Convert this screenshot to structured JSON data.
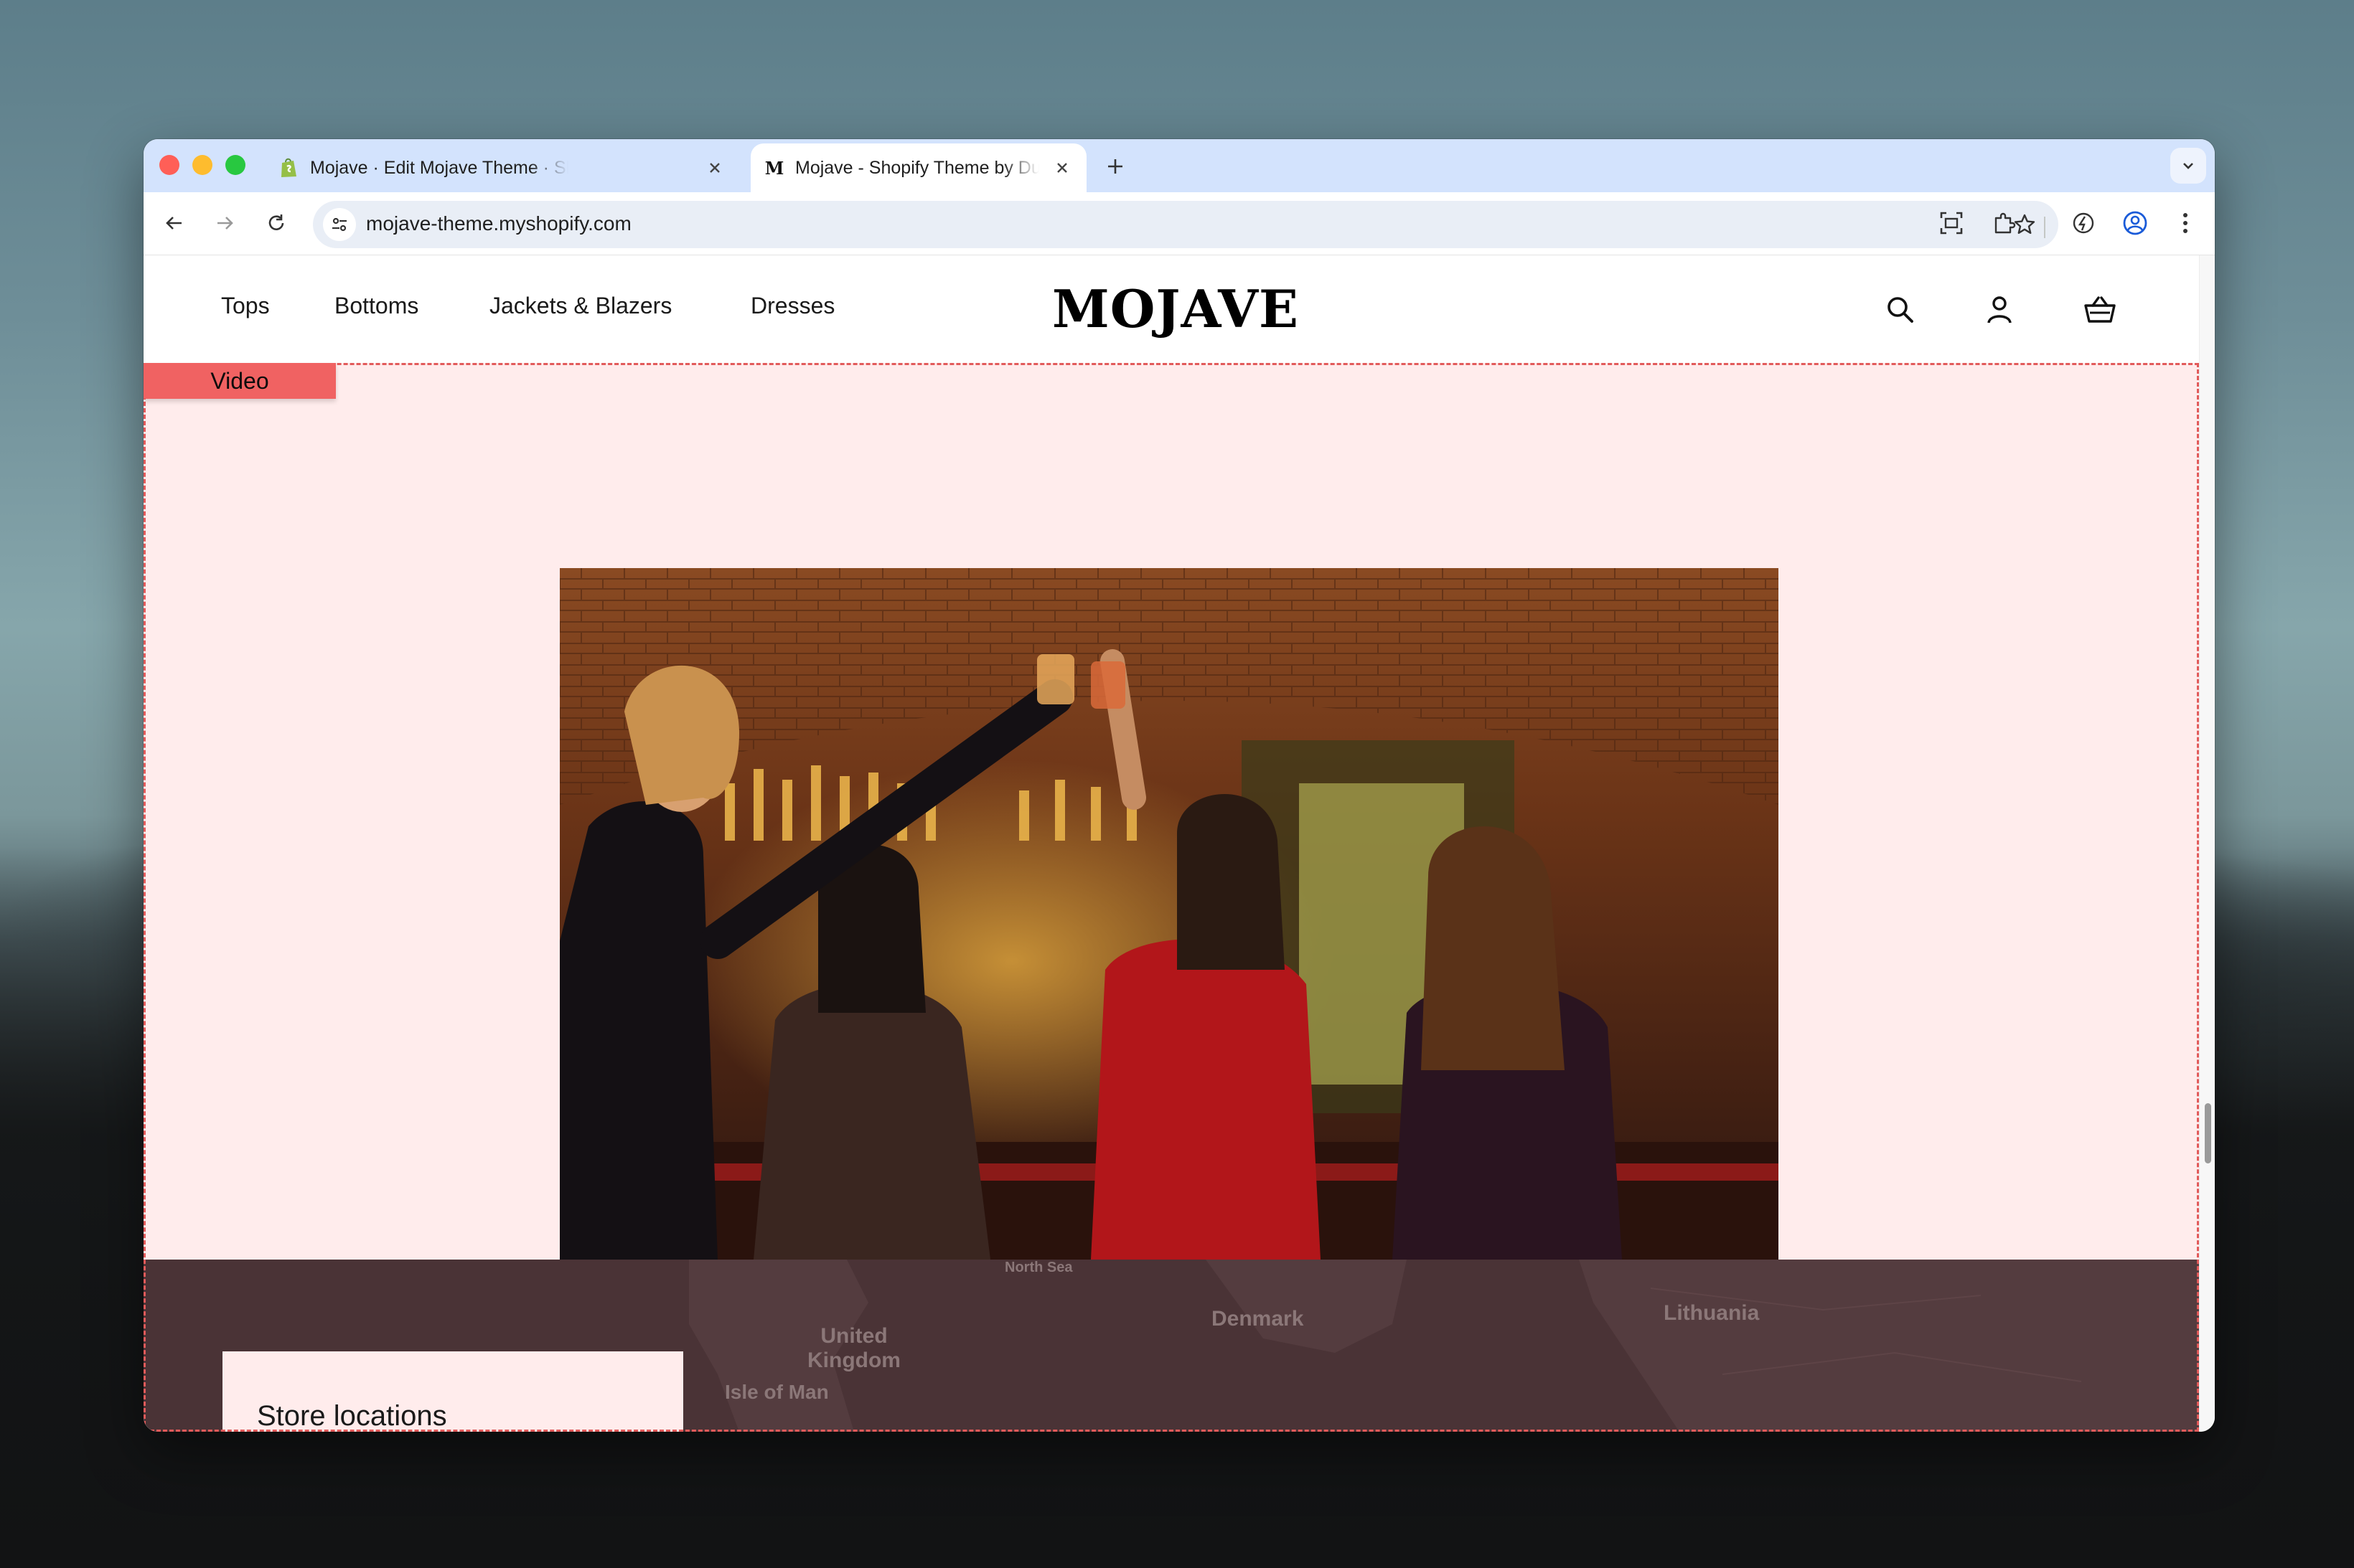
{
  "browser": {
    "tabs": [
      {
        "title": "Mojave · Edit Mojave Theme · Shopify",
        "favicon": "shopify-icon",
        "active": false
      },
      {
        "title": "Mojave - Shopify Theme by Dualyan",
        "favicon": "m-letter-icon",
        "favicon_text": "M",
        "active": true
      }
    ],
    "url": "mojave-theme.myshopify.com"
  },
  "site": {
    "logo": "MOJAVE",
    "nav": [
      "Tops",
      "Bottoms",
      "Jackets & Blazers",
      "Dresses"
    ]
  },
  "editor": {
    "section_label": "Video"
  },
  "map": {
    "labels": {
      "north_sea": "North Sea",
      "uk": "United Kingdom",
      "isle_of_man": "Isle of Man",
      "denmark": "Denmark",
      "lithuania": "Lithuania"
    },
    "store_card_title": "Store locations"
  },
  "colors": {
    "section_background": "#ffecec",
    "editor_outline": "#e25a5a",
    "map_background": "#4a3336",
    "tabstrip": "#d3e3fd"
  }
}
